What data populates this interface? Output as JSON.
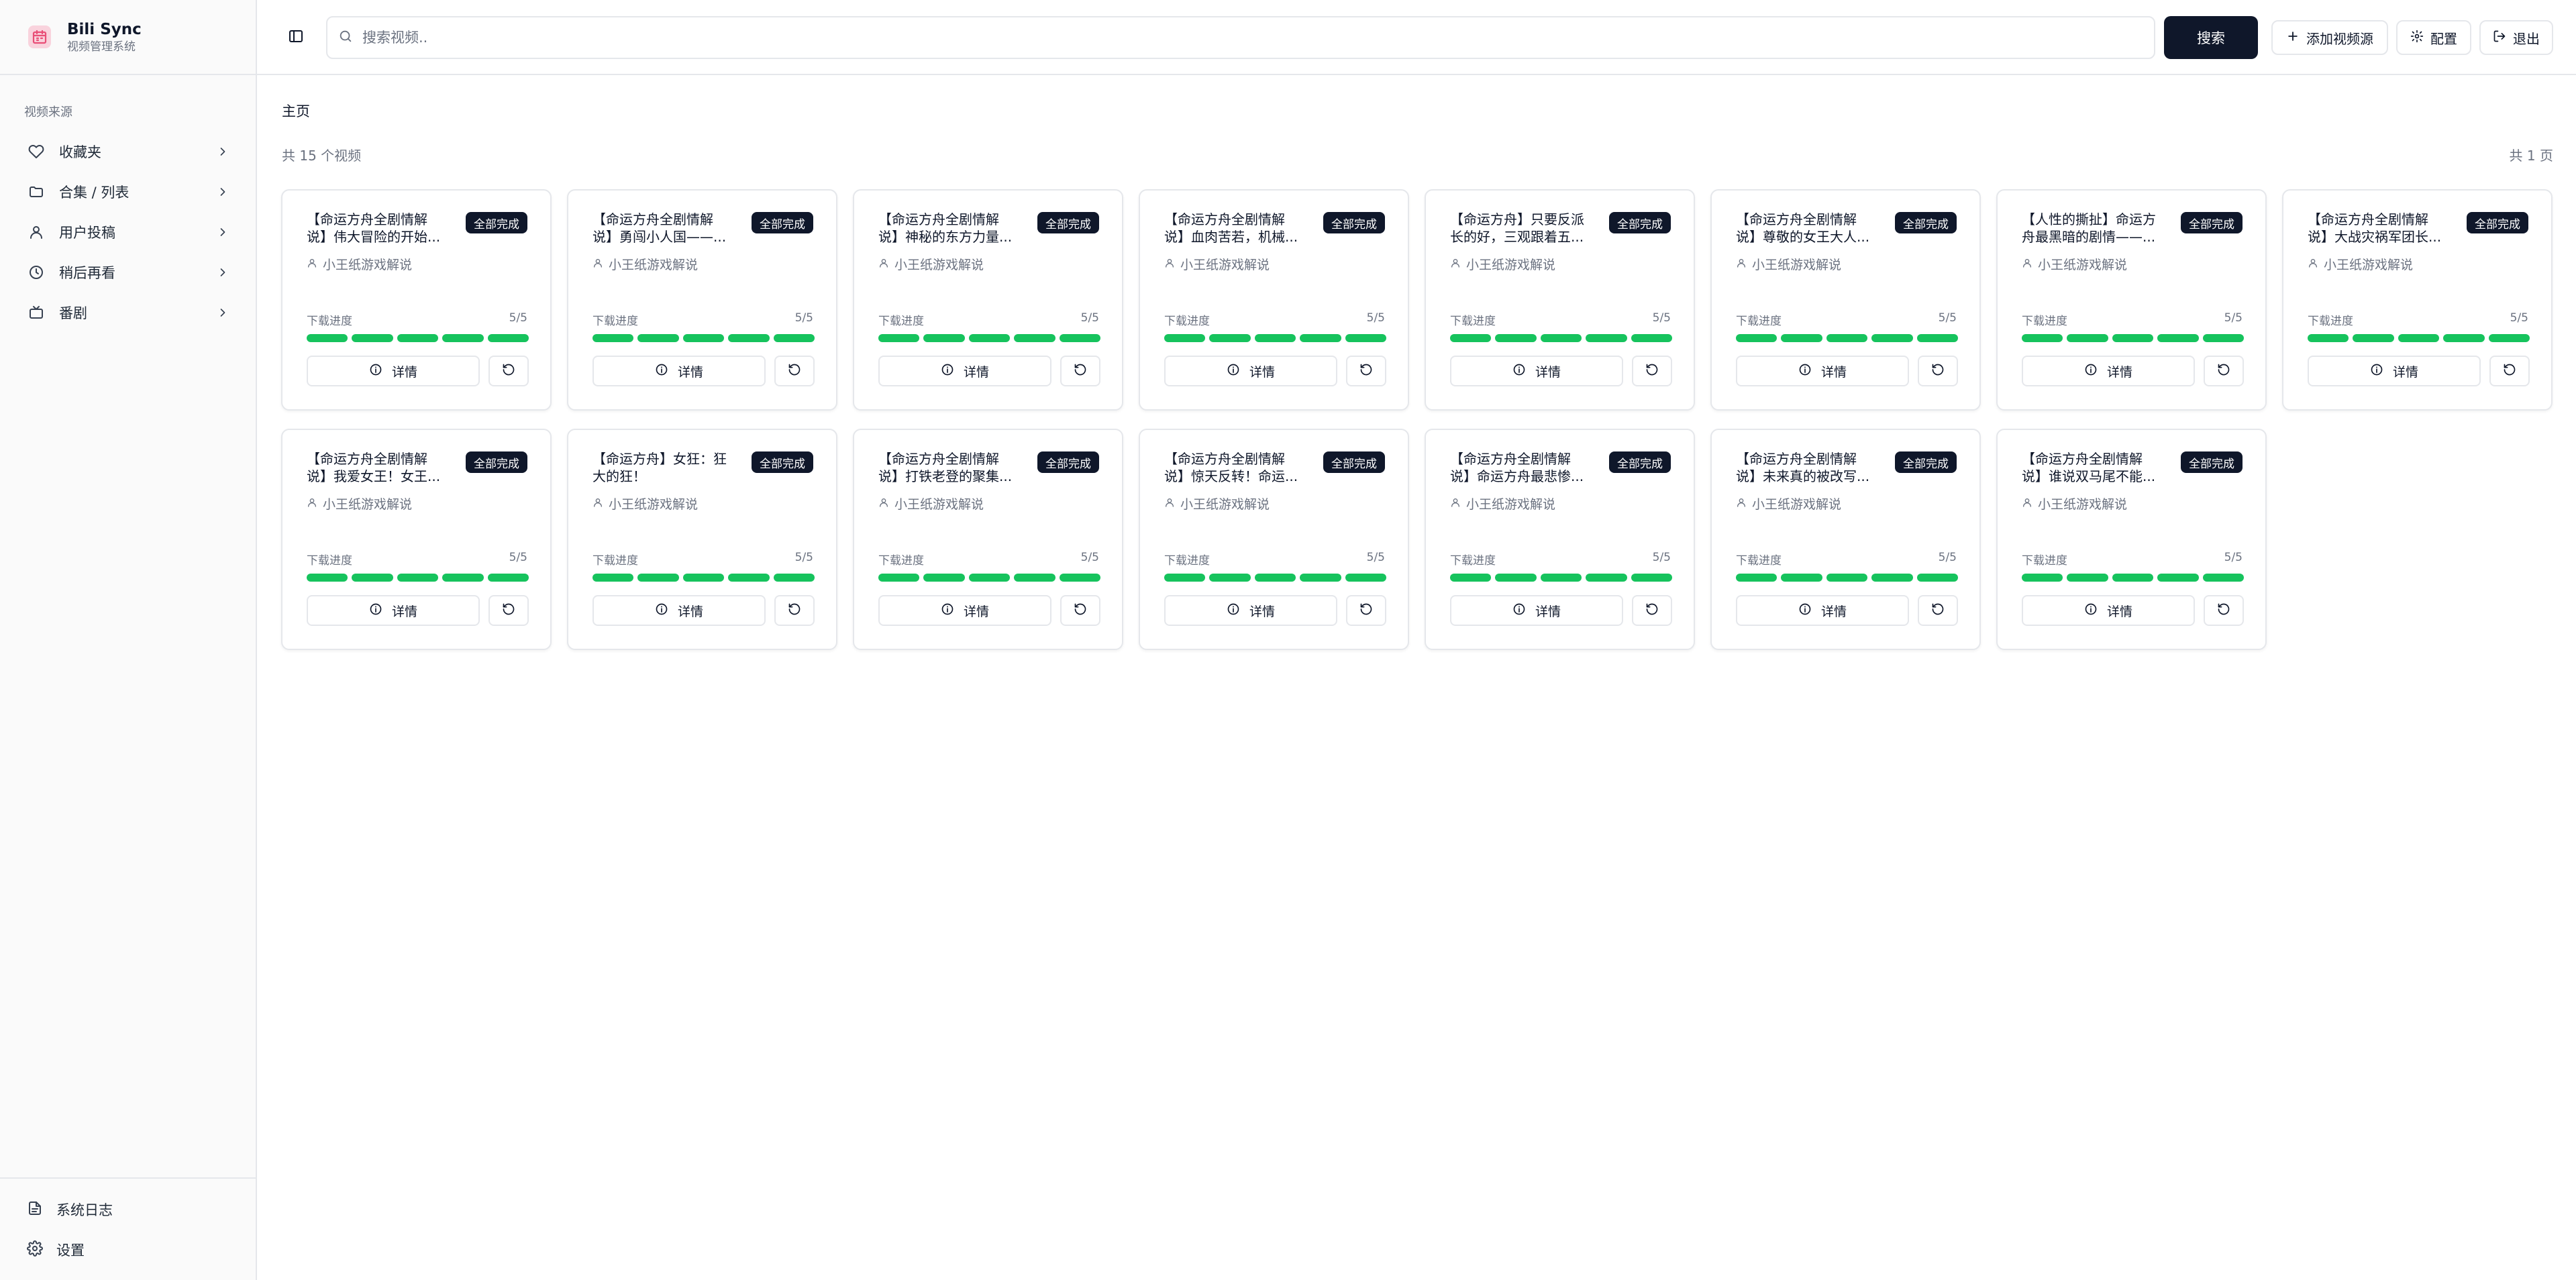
{
  "brand": {
    "title": "Bili Sync",
    "subtitle": "视频管理系统"
  },
  "sidebar": {
    "section_label": "视频来源",
    "items": [
      {
        "label": "收藏夹",
        "icon": "heart-icon"
      },
      {
        "label": "合集 / 列表",
        "icon": "folder-icon"
      },
      {
        "label": "用户投稿",
        "icon": "user-icon"
      },
      {
        "label": "稍后再看",
        "icon": "clock-icon"
      },
      {
        "label": "番剧",
        "icon": "tv-icon"
      }
    ],
    "bottom": [
      {
        "label": "系统日志",
        "icon": "file-icon"
      },
      {
        "label": "设置",
        "icon": "gear-icon"
      }
    ]
  },
  "header": {
    "search_placeholder": "搜索视频..",
    "search_button": "搜索",
    "add_source": "添加视频源",
    "config": "配置",
    "logout": "退出"
  },
  "main": {
    "title": "主页",
    "count": "共 15 个视频",
    "pages": "共 1 页"
  },
  "colors": {
    "primary": "#0f172a",
    "progress": "#16c35d",
    "border": "#e5e7eb",
    "logo": "#e94e77"
  },
  "card_common": {
    "badge": "全部完成",
    "progress_label": "下载进度",
    "progress_text": "5/5",
    "progress_done": 5,
    "progress_total": 5,
    "detail_label": "详情"
  },
  "videos": [
    {
      "title_line1": "【命运方舟全剧情解",
      "title_line2": "说】伟大冒险的开始...",
      "author": "小王纸游戏解说"
    },
    {
      "title_line1": "【命运方舟全剧情解",
      "title_line2": "说】勇闯小人国——...",
      "author": "小王纸游戏解说"
    },
    {
      "title_line1": "【命运方舟全剧情解",
      "title_line2": "说】神秘的东方力量...",
      "author": "小王纸游戏解说"
    },
    {
      "title_line1": "【命运方舟全剧情解",
      "title_line2": "说】血肉苦若，机械...",
      "author": "小王纸游戏解说"
    },
    {
      "title_line1": "【命运方舟】只要反派",
      "title_line2": "长的好，三观跟着五...",
      "author": "小王纸游戏解说"
    },
    {
      "title_line1": "【命运方舟全剧情解",
      "title_line2": "说】尊敬的女王大人...",
      "author": "小王纸游戏解说"
    },
    {
      "title_line1": "【人性的撕扯】命运方",
      "title_line2": "舟最黑暗的剧情——...",
      "author": "小王纸游戏解说"
    },
    {
      "title_line1": "【命运方舟全剧情解",
      "title_line2": "说】大战灾祸军团长...",
      "author": "小王纸游戏解说"
    },
    {
      "title_line1": "【命运方舟全剧情解",
      "title_line2": "说】我爱女王！女王...",
      "author": "小王纸游戏解说"
    },
    {
      "title_line1": "【命运方舟】女狂：狂",
      "title_line2": "大的狂！",
      "author": "小王纸游戏解说"
    },
    {
      "title_line1": "【命运方舟全剧情解",
      "title_line2": "说】打铁老登的聚集...",
      "author": "小王纸游戏解说"
    },
    {
      "title_line1": "【命运方舟全剧情解",
      "title_line2": "说】惊天反转！命运...",
      "author": "小王纸游戏解说"
    },
    {
      "title_line1": "【命运方舟全剧情解",
      "title_line2": "说】命运方舟最悲惨...",
      "author": "小王纸游戏解说"
    },
    {
      "title_line1": "【命运方舟全剧情解",
      "title_line2": "说】未来真的被改写...",
      "author": "小王纸游戏解说"
    },
    {
      "title_line1": "【命运方舟全剧情解",
      "title_line2": "说】谁说双马尾不能...",
      "author": "小王纸游戏解说"
    }
  ]
}
